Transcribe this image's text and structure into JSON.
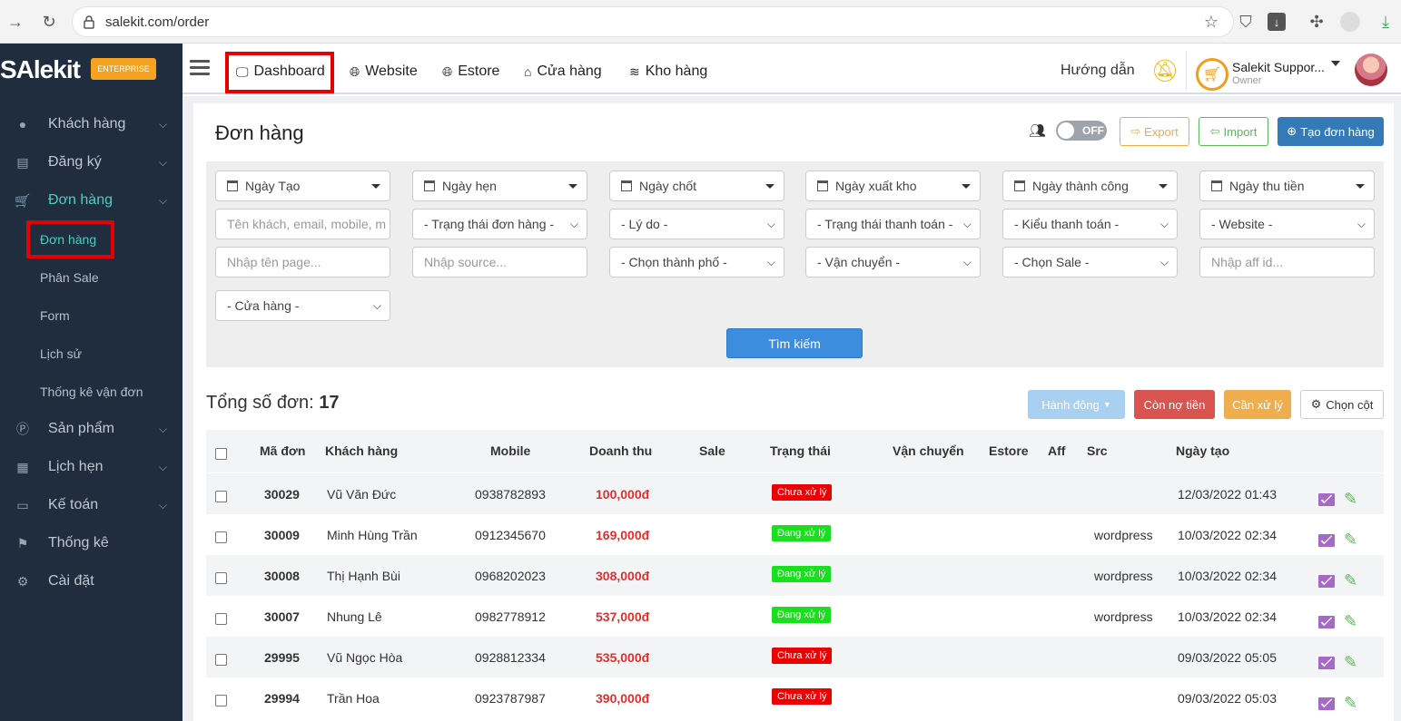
{
  "browser": {
    "url": "salekit.com/order"
  },
  "brand": {
    "logo": "SAlekit",
    "badge": "ENTERPRISE"
  },
  "sidebar": {
    "items": [
      {
        "label": "Khách hàng",
        "icon": "user-icon"
      },
      {
        "label": "Đăng ký",
        "icon": "list-icon"
      },
      {
        "label": "Đơn hàng",
        "icon": "cart-icon"
      },
      {
        "label": "Sản phẩm",
        "icon": "product-icon"
      },
      {
        "label": "Lịch hẹn",
        "icon": "calendar-icon"
      },
      {
        "label": "Kế toán",
        "icon": "card-icon"
      },
      {
        "label": "Thống kê",
        "icon": "flag-icon"
      },
      {
        "label": "Cài đặt",
        "icon": "gear-icon"
      }
    ],
    "subitems": [
      "Đơn hàng",
      "Phân Sale",
      "Form",
      "Lịch sử",
      "Thống kê vận đơn"
    ]
  },
  "topnav": {
    "dashboard": "Dashboard",
    "website": "Website",
    "estore": "Estore",
    "store": "Cửa hàng",
    "warehouse": "Kho hàng",
    "help": "Hướng dẫn",
    "user_name": "Salekit Suppor...",
    "user_role": "Owner"
  },
  "page": {
    "title": "Đơn hàng",
    "toggle": "OFF",
    "export": "Export",
    "import": "Import",
    "create": "Tạo đơn hàng"
  },
  "filters": {
    "dates": [
      "Ngày Tạo",
      "Ngày hẹn",
      "Ngày chốt",
      "Ngày xuất kho",
      "Ngày thành công",
      "Ngày thu tiền"
    ],
    "customer_placeholder": "Tên khách, email, mobile, m",
    "order_status": "- Trạng thái đơn hàng -",
    "reason": "- Lý do -",
    "payment_status": "- Trạng thái thanh toán -",
    "payment_type": "- Kiểu thanh toán -",
    "website": "- Website -",
    "page_placeholder": "Nhập tên page...",
    "source_placeholder": "Nhập source...",
    "city": "- Chọn thành phố -",
    "shipping": "- Vận chuyển -",
    "sale": "- Chọn Sale -",
    "aff_placeholder": "Nhập aff id...",
    "store": "- Cửa hàng -",
    "search": "Tìm kiếm"
  },
  "summary": {
    "total_label": "Tổng số đơn:",
    "total_value": "17",
    "action": "Hành động",
    "debt": "Còn nợ tiền",
    "todo": "Cần xử lý",
    "columns": "Chọn cột"
  },
  "table": {
    "headers": [
      "Mã đơn",
      "Khách hàng",
      "Mobile",
      "Doanh thu",
      "Sale",
      "Trạng thái",
      "Vận chuyển",
      "Estore",
      "Aff",
      "Src",
      "Ngày tạo"
    ],
    "rows": [
      {
        "code": "30029",
        "customer": "Vũ Văn Đức",
        "mobile": "0938782893",
        "revenue": "100,000đ",
        "status": "Chưa xử lý",
        "src": "",
        "date": "12/03/2022 01:43"
      },
      {
        "code": "30009",
        "customer": "Minh Hùng Trần",
        "mobile": "0912345670",
        "revenue": "169,000đ",
        "status": "Đang xử lý",
        "src": "wordpress",
        "date": "10/03/2022 02:34"
      },
      {
        "code": "30008",
        "customer": "Thị Hạnh Bùi",
        "mobile": "0968202023",
        "revenue": "308,000đ",
        "status": "Đang xử lý",
        "src": "wordpress",
        "date": "10/03/2022 02:34"
      },
      {
        "code": "30007",
        "customer": "Nhung Lê",
        "mobile": "0982778912",
        "revenue": "537,000đ",
        "status": "Đang xử lý",
        "src": "wordpress",
        "date": "10/03/2022 02:34"
      },
      {
        "code": "29995",
        "customer": "Vũ Ngọc Hòa",
        "mobile": "0928812334",
        "revenue": "535,000đ",
        "status": "Chưa xử lý",
        "src": "",
        "date": "09/03/2022 05:05"
      },
      {
        "code": "29994",
        "customer": "Trần Hoa",
        "mobile": "0923787987",
        "revenue": "390,000đ",
        "status": "Chưa xử lý",
        "src": "",
        "date": "09/03/2022 05:03"
      }
    ]
  },
  "colors": {
    "sidebar_bg": "#1f2d3f",
    "accent": "#4ecdc4",
    "primary": "#337ab7",
    "danger": "#ee0000",
    "success": "#19e01c"
  }
}
